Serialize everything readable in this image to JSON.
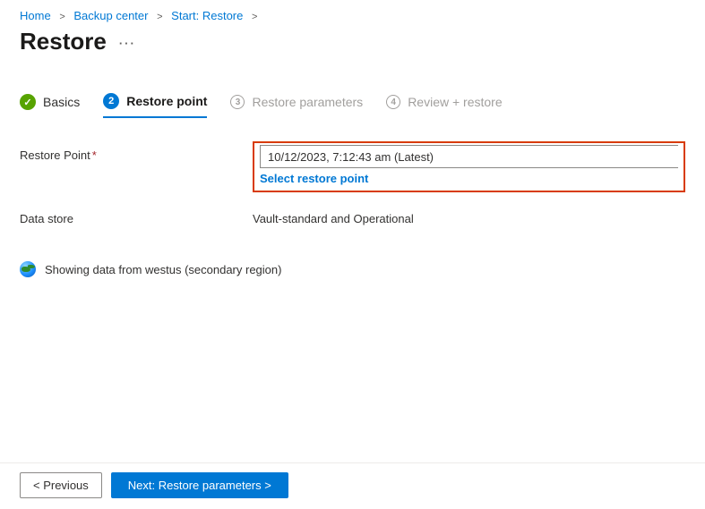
{
  "breadcrumb": {
    "home": "Home",
    "backup_center": "Backup center",
    "start_restore": "Start: Restore"
  },
  "page_title": "Restore",
  "steps": {
    "basics": {
      "label": "Basics"
    },
    "restore_point": {
      "label": "Restore point",
      "badge": "2"
    },
    "restore_parameters": {
      "label": "Restore parameters",
      "badge": "3"
    },
    "review": {
      "label": "Review + restore",
      "badge": "4"
    }
  },
  "form": {
    "restore_point_label": "Restore Point",
    "restore_point_value": "10/12/2023, 7:12:43 am (Latest)",
    "select_link": "Select restore point",
    "data_store_label": "Data store",
    "data_store_value": "Vault-standard and Operational"
  },
  "region_note": "Showing data from westus (secondary region)",
  "footer": {
    "previous": "< Previous",
    "next": "Next: Restore parameters >"
  }
}
